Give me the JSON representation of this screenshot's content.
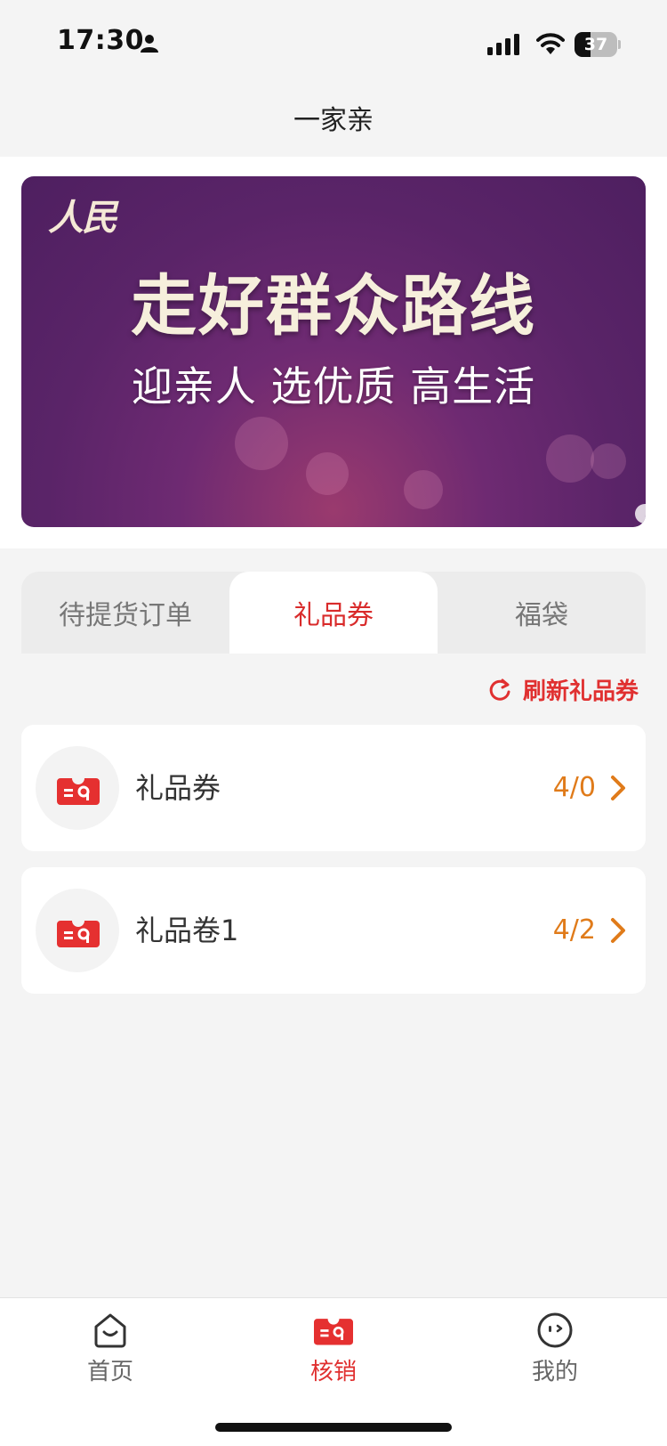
{
  "status_bar": {
    "time": "17:30",
    "battery": "37",
    "battery_level": 0.37,
    "icons": [
      "person-icon",
      "signal-icon",
      "wifi-icon",
      "battery-icon"
    ]
  },
  "header": {
    "title": "一家亲"
  },
  "banner": {
    "brand": "人民",
    "headline": "走好群众路线",
    "subline": "迎亲人 选优质 高生活"
  },
  "tabs": [
    {
      "label": "待提货订单",
      "active": false
    },
    {
      "label": "礼品券",
      "active": true
    },
    {
      "label": "福袋",
      "active": false
    }
  ],
  "refresh": {
    "label": "刷新礼品券",
    "icon": "refresh-icon"
  },
  "vouchers": [
    {
      "label": "礼品券",
      "count": "4/0",
      "icon": "ticket-icon"
    },
    {
      "label": "礼品卷1",
      "count": "4/2",
      "icon": "ticket-icon"
    }
  ],
  "bottom_nav": [
    {
      "label": "首页",
      "icon": "home-icon",
      "active": false
    },
    {
      "label": "核销",
      "icon": "ticket-icon",
      "active": true
    },
    {
      "label": "我的",
      "icon": "profile-face-icon",
      "active": false
    }
  ],
  "colors": {
    "accent_red": "#e03030",
    "count_orange": "#e07b1a",
    "banner_purple": "#5a2468"
  }
}
